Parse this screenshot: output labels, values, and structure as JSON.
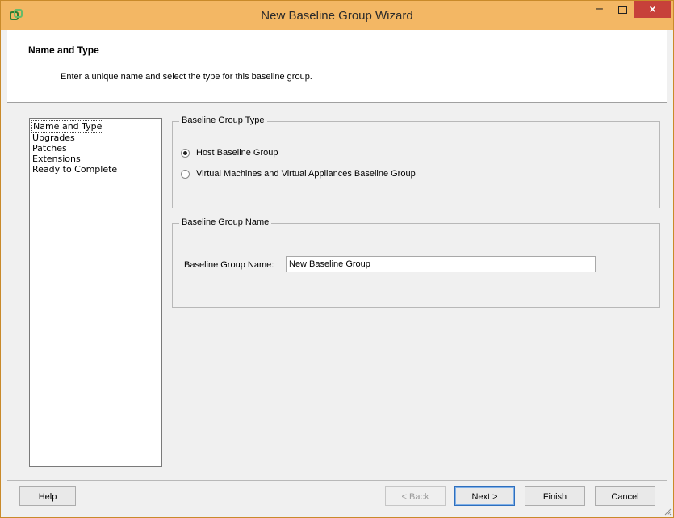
{
  "window": {
    "title": "New Baseline Group Wizard",
    "app_icon": "vsphere-icon",
    "controls": {
      "minimize": "–",
      "maximize": "☐",
      "close": "×"
    },
    "colors": {
      "titlebar": "#f3b764",
      "close": "#c7413a"
    }
  },
  "header": {
    "title": "Name and Type",
    "description": "Enter a unique name and select the type for this baseline group."
  },
  "steps": [
    {
      "label": "Name and Type",
      "current": true
    },
    {
      "label": "Upgrades",
      "current": false
    },
    {
      "label": "Patches",
      "current": false
    },
    {
      "label": "Extensions",
      "current": false
    },
    {
      "label": "Ready to Complete",
      "current": false
    }
  ],
  "type_group": {
    "legend": "Baseline Group Type",
    "options": [
      {
        "label": "Host Baseline Group",
        "checked": true
      },
      {
        "label": "Virtual Machines and Virtual Appliances Baseline Group",
        "checked": false
      }
    ]
  },
  "name_group": {
    "legend": "Baseline Group Name",
    "field_label": "Baseline Group Name:",
    "field_value": "New Baseline Group"
  },
  "buttons": {
    "help": "Help",
    "back": "< Back",
    "next": "Next >",
    "finish": "Finish",
    "cancel": "Cancel"
  }
}
